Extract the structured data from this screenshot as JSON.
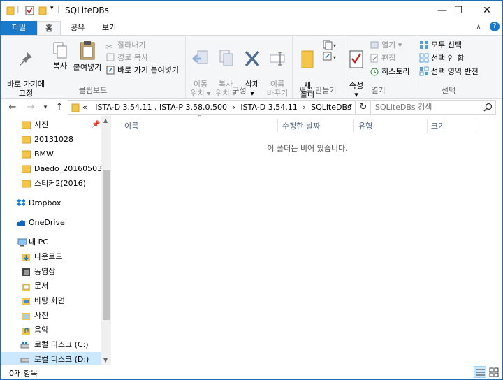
{
  "window": {
    "title": "SQLiteDBs",
    "controls": {
      "minimize": "—",
      "maximize": "☐",
      "close": "✕"
    }
  },
  "tabs": [
    {
      "label": "파일",
      "type": "file"
    },
    {
      "label": "홈",
      "type": "active"
    },
    {
      "label": "공유",
      "type": "normal"
    },
    {
      "label": "보기",
      "type": "normal"
    }
  ],
  "ribbon": {
    "clipboard": {
      "label": "클립보드",
      "pin": "바로 가기에\n고정",
      "copy": "복사",
      "paste": "붙여넣기",
      "cut": "잘라내기",
      "copy_path": "경로 복사",
      "paste_shortcut": "바로 가기 붙여넣기"
    },
    "organize": {
      "label": "구성",
      "move_to": "이동\n위치 ▾",
      "copy_to": "복사\n위치 ▾",
      "delete": "삭제\n▾",
      "rename": "이름\n바꾸기"
    },
    "new": {
      "label": "새로 만들기",
      "new_folder": "새\n폴더"
    },
    "open": {
      "label": "열기",
      "properties": "속성\n▾",
      "open": "열기 ▾",
      "edit": "편집",
      "history": "히스토리"
    },
    "select": {
      "label": "선택",
      "select_all": "모두 선택",
      "select_none": "선택 안 함",
      "invert": "선택 영역 반전"
    },
    "help_icon": "?",
    "collapse_icon": "∧"
  },
  "address": {
    "prefix": "«",
    "crumbs": [
      "ISTA-D 3.54.11 , ISTA-P 3.58.0.500",
      "ISTA-D 3.54.11",
      "SQLiteDBs"
    ],
    "separator": "›",
    "search_placeholder": "SQLiteDBs 검색"
  },
  "nav": [
    {
      "label": "사진",
      "icon": "folder",
      "pinned": true
    },
    {
      "label": "20131028",
      "icon": "folder"
    },
    {
      "label": "BMW",
      "icon": "folder"
    },
    {
      "label": "Daedo_20160503_2",
      "icon": "folder"
    },
    {
      "label": "스티커2(2016)",
      "icon": "folder"
    },
    {
      "label": "Dropbox",
      "icon": "dropbox"
    },
    {
      "label": "OneDrive",
      "icon": "onedrive"
    },
    {
      "label": "내 PC",
      "icon": "pc"
    },
    {
      "label": "다운로드",
      "icon": "download"
    },
    {
      "label": "동영상",
      "icon": "video"
    },
    {
      "label": "문서",
      "icon": "doc"
    },
    {
      "label": "바탕 화면",
      "icon": "desktop"
    },
    {
      "label": "사진",
      "icon": "pictures"
    },
    {
      "label": "음악",
      "icon": "music"
    },
    {
      "label": "로컬 디스크 (C:)",
      "icon": "drive"
    },
    {
      "label": "로컬 디스크 (D:)",
      "icon": "drive",
      "selected": true
    }
  ],
  "columns": [
    "이름",
    "수정한 날짜",
    "유형",
    "크기"
  ],
  "empty_message": "이 폴더는 비어 있습니다.",
  "status": "0개 항목",
  "colors": {
    "accent": "#1979ca",
    "folder": "#f3c54a",
    "selection": "#cce8ff"
  }
}
